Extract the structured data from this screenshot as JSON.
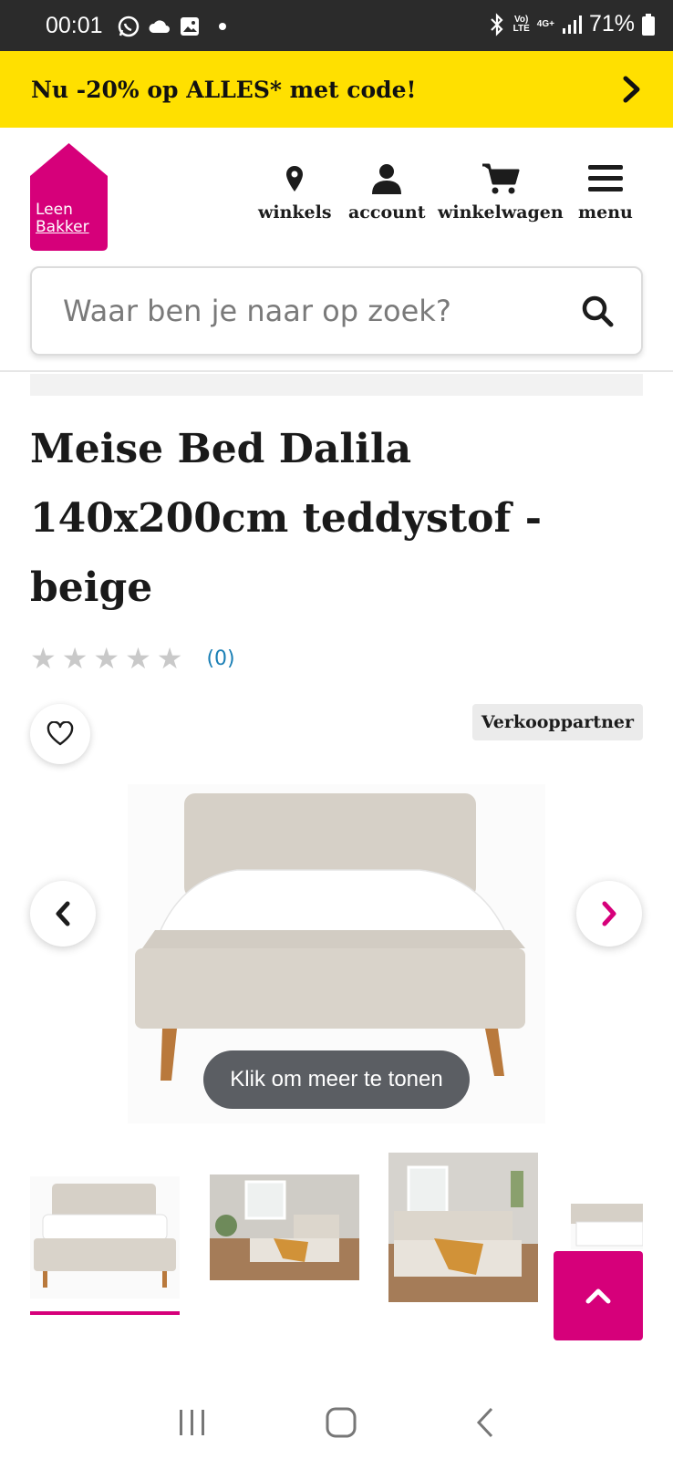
{
  "status_bar": {
    "time": "00:01",
    "battery": "71%",
    "network": "4G+",
    "volte_line1": "Vo)",
    "volte_line2": "LTE"
  },
  "promo": {
    "text": "Nu -20% op ALLES* met code!"
  },
  "header": {
    "logo_line1": "Leen",
    "logo_line2": "Bakker",
    "brand_color": "#d6007a",
    "nav": [
      {
        "label": "winkels",
        "icon": "map-pin-icon"
      },
      {
        "label": "account",
        "icon": "user-icon"
      },
      {
        "label": "winkelwagen",
        "icon": "cart-icon"
      },
      {
        "label": "menu",
        "icon": "hamburger-icon"
      }
    ]
  },
  "search": {
    "placeholder": "Waar ben je naar op zoek?"
  },
  "product": {
    "title": "Meise Bed Dalila 140x200cm teddystof - beige",
    "rating_stars": 0,
    "max_stars": 5,
    "review_count": "(0)",
    "badge": "Verkooppartner",
    "more_label": "Klik om meer te tonen"
  },
  "colors": {
    "promo_bg": "#ffe000",
    "accent": "#d6007a",
    "link": "#1a7fb5"
  }
}
